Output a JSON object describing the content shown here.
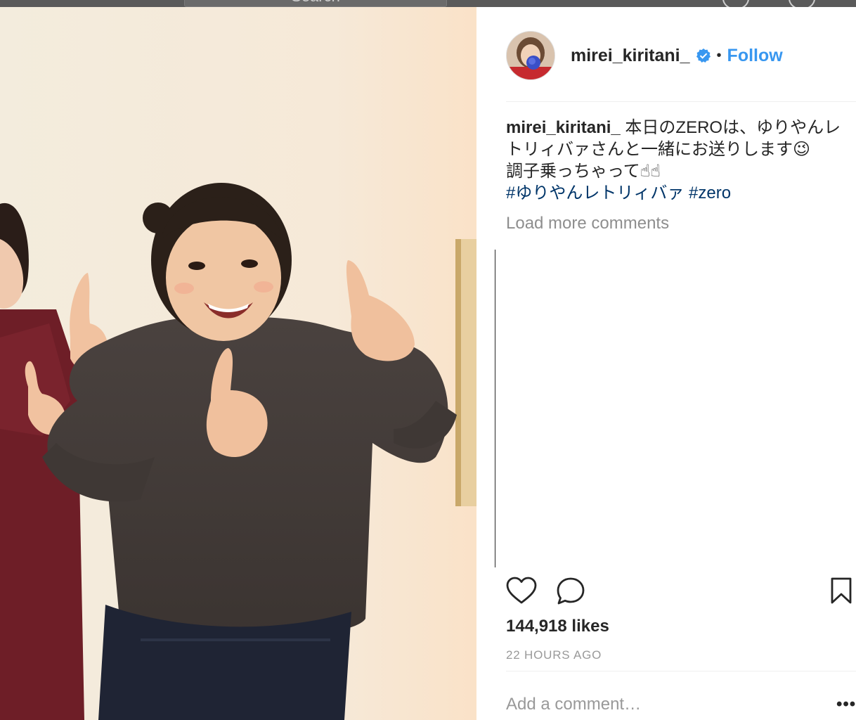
{
  "topbar": {
    "search_placeholder": "Search"
  },
  "post": {
    "username": "mirei_kiritani_",
    "verified_icon": "verified-badge-icon",
    "separator": "•",
    "follow_label": "Follow",
    "caption_username": "mirei_kiritani_",
    "caption_line1": " 本日のZEROは、ゆりやんレトリィバァさんと一緒にお送りします😉",
    "caption_line2": "調子乗っちゃって☝☝",
    "hashtags": "#ゆりやんレトリィバァ #zero",
    "load_more": "Load more comments",
    "likes": "144,918 likes",
    "time_ago": "22 HOURS AGO",
    "comment_placeholder": "Add a comment…",
    "options_label": "•••"
  },
  "colors": {
    "accent": "#3897f0",
    "hashtag": "#003569",
    "muted": "#8e8e8e",
    "text": "#262626"
  }
}
